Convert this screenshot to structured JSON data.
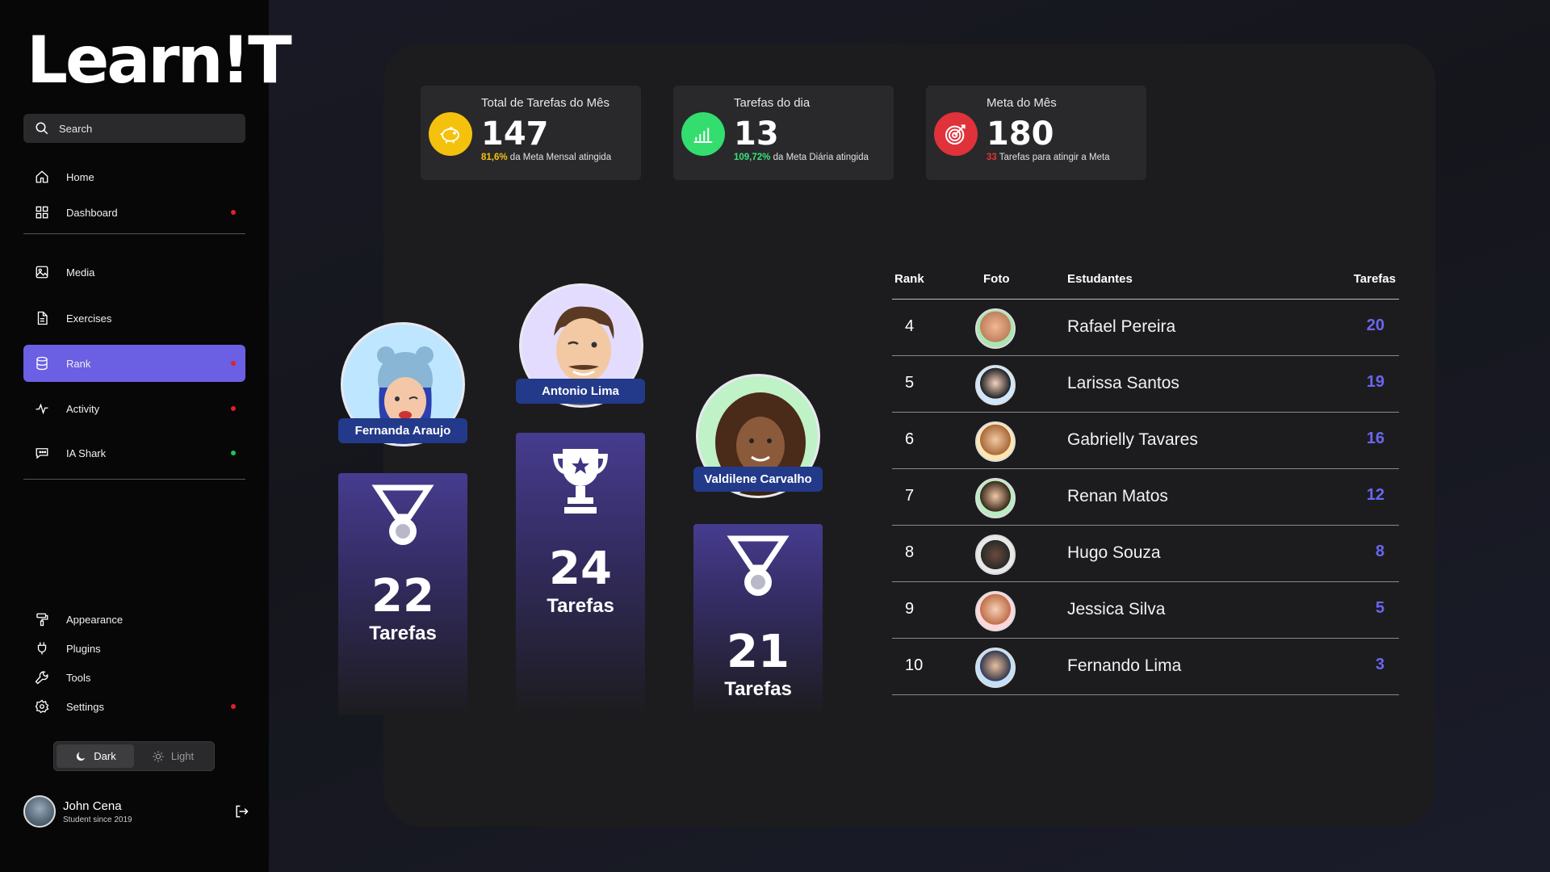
{
  "app": {
    "logo": "Learn!T"
  },
  "search": {
    "label": "Search"
  },
  "sidebar": {
    "items": [
      {
        "label": "Home",
        "icon": "home-icon",
        "dot": ""
      },
      {
        "label": "Dashboard",
        "icon": "grid-icon",
        "dot": "#e0202a"
      },
      {
        "label": "Media",
        "icon": "image-icon",
        "dot": ""
      },
      {
        "label": "Exercises",
        "icon": "document-icon",
        "dot": ""
      },
      {
        "label": "Rank",
        "icon": "database-icon",
        "dot": "#e0202a",
        "active": true
      },
      {
        "label": "Activity",
        "icon": "pulse-icon",
        "dot": "#e0202a"
      },
      {
        "label": "IA Shark",
        "icon": "chat-icon",
        "dot": "#21c45a"
      }
    ],
    "bottom_items": [
      {
        "label": "Appearance",
        "icon": "paint-roller-icon",
        "dot": ""
      },
      {
        "label": "Plugins",
        "icon": "plug-icon",
        "dot": ""
      },
      {
        "label": "Tools",
        "icon": "wrench-icon",
        "dot": ""
      },
      {
        "label": "Settings",
        "icon": "gear-icon",
        "dot": "#e0202a"
      }
    ]
  },
  "theme": {
    "dark_label": "Dark",
    "light_label": "Light",
    "selected": "Dark"
  },
  "profile": {
    "name": "John Cena",
    "subtitle": "Student since 2019"
  },
  "stats": [
    {
      "title": "Total de Tarefas do Mês",
      "value": "147",
      "highlight": "81,6%",
      "rest": " da Meta Mensal atingida",
      "highlight_color": "#f4c20d",
      "icon": "piggy-bank-icon",
      "icon_bg": "#f4c20d"
    },
    {
      "title": "Tarefas do dia",
      "value": "13",
      "highlight": "109,72%",
      "rest": " da Meta Diária atingida",
      "highlight_color": "#3be07a",
      "icon": "signal-bars-icon",
      "icon_bg": "#33dd6e"
    },
    {
      "title": "Meta do Mês",
      "value": "180",
      "highlight": "33",
      "rest": " Tarefas para atingir a Meta",
      "highlight_color": "#e0323a",
      "icon": "target-icon",
      "icon_bg": "#e0323a"
    }
  ],
  "podium": [
    {
      "name": "Fernanda Araujo",
      "tasks": "22",
      "label": "Tarefas",
      "place": 2,
      "icon": "medal-icon"
    },
    {
      "name": "Antonio Lima",
      "tasks": "24",
      "label": "Tarefas",
      "place": 1,
      "icon": "trophy-icon"
    },
    {
      "name": "Valdilene Carvalho",
      "tasks": "21",
      "label": "Tarefas",
      "place": 3,
      "icon": "medal-icon"
    }
  ],
  "table": {
    "headers": {
      "rank": "Rank",
      "foto": "Foto",
      "students": "Estudantes",
      "tasks": "Tarefas"
    },
    "rows": [
      {
        "rank": "4",
        "name": "Rafael Pereira",
        "tasks": "20"
      },
      {
        "rank": "5",
        "name": "Larissa Santos",
        "tasks": "19"
      },
      {
        "rank": "6",
        "name": "Gabrielly Tavares",
        "tasks": "16"
      },
      {
        "rank": "7",
        "name": "Renan Matos",
        "tasks": "12"
      },
      {
        "rank": "8",
        "name": "Hugo Souza",
        "tasks": "8"
      },
      {
        "rank": "9",
        "name": "Jessica Silva",
        "tasks": "5"
      },
      {
        "rank": "10",
        "name": "Fernando Lima",
        "tasks": "3"
      }
    ]
  },
  "colors": {
    "accent": "#6b5fe3",
    "tasks_accent": "#6b66f0",
    "pill": "#233a8a"
  }
}
